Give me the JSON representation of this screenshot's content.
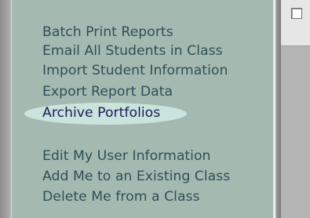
{
  "menu": {
    "group1": [
      {
        "label": "Batch Print Reports",
        "name": "menu-item-batch-print-reports"
      },
      {
        "label": "Email All Students in Class",
        "name": "menu-item-email-all-students"
      },
      {
        "label": "Import Student Information",
        "name": "menu-item-import-student-information"
      },
      {
        "label": "Export Report Data",
        "name": "menu-item-export-report-data"
      },
      {
        "label": "Archive Portfolios",
        "name": "menu-item-archive-portfolios"
      }
    ],
    "group2": [
      {
        "label": "Edit My User Information",
        "name": "menu-item-edit-my-user-information"
      },
      {
        "label": "Add Me to an Existing Class",
        "name": "menu-item-add-me-to-class"
      },
      {
        "label": "Delete Me from a Class",
        "name": "menu-item-delete-me-from-class"
      }
    ],
    "highlighted_item": "Archive Portfolios"
  },
  "colors": {
    "panel_background": "#a4bab0",
    "link_text": "#2f4f57",
    "highlight": "#c8e4dc"
  }
}
